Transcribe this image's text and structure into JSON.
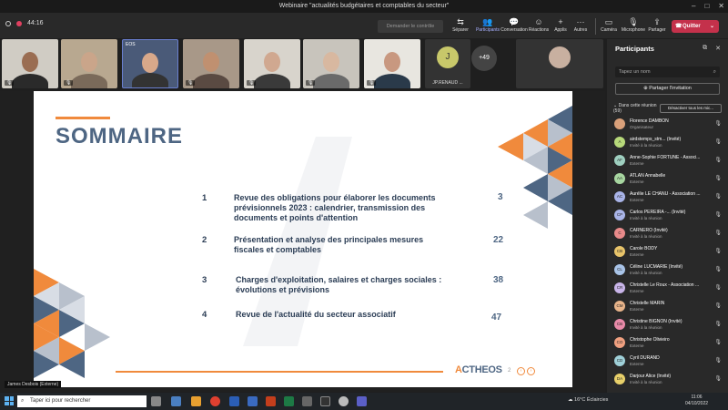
{
  "window": {
    "title": "Webinaire \"actualités budgétaires et comptables du secteur\"",
    "controls": [
      "–",
      "□",
      "✕"
    ]
  },
  "toolbar": {
    "timer": "44:16",
    "ask_control": "Demander le contrôle",
    "items": [
      {
        "label": "Séparer",
        "icon": "split-icon"
      },
      {
        "label": "Participants",
        "icon": "people-icon",
        "active": true
      },
      {
        "label": "Conversation",
        "icon": "chat-icon"
      },
      {
        "label": "Réactions",
        "icon": "reaction-icon"
      },
      {
        "label": "Applis",
        "icon": "apps-icon"
      },
      {
        "label": "Autres",
        "icon": "more-icon"
      },
      {
        "label": "Caméra",
        "icon": "camera-off-icon"
      },
      {
        "label": "Microphone",
        "icon": "mic-off-icon"
      },
      {
        "label": "Partager",
        "icon": "share-icon"
      }
    ],
    "leave": "Quitter"
  },
  "tiles": {
    "eos_tag": "EOS",
    "avatar_initial": "J",
    "avatar_name": "JP.RENAUD ...",
    "more_count": "+49"
  },
  "slide": {
    "heading": "SOMMAIRE",
    "items": [
      {
        "num": "1",
        "lines": [
          "Revue des obligations pour élaborer les documents",
          "prévisionnels 2023 : calendrier, transmission des",
          "documents et points d'attention"
        ],
        "page": "3"
      },
      {
        "num": "2",
        "lines": [
          "Présentation et analyse des principales mesures",
          "fiscales et comptables"
        ],
        "page": "22"
      },
      {
        "num": "3",
        "lines": [
          "Charges d'exploitation, salaires et charges sociales :",
          "évolutions et prévisions"
        ],
        "page": "38"
      },
      {
        "num": "4",
        "lines": [
          "Revue de l'actualité du secteur associatif"
        ],
        "page": "47"
      }
    ],
    "logo_a": "A",
    "logo_rest": "CTHEOS",
    "page_number": "2",
    "colors": {
      "orange": "#f08a3c",
      "navy": "#4e6683",
      "gray": "#b8c0cc"
    }
  },
  "presenter": "James Desbois (Externe)",
  "panel": {
    "title": "Participants",
    "search_placeholder": "Tapez un nom",
    "share_invite": "Partager l'invitation",
    "meeting_header": "Dans cette réunion",
    "meeting_count": "(59)",
    "mute_all": "Désactiver tous les mic...",
    "participants": [
      {
        "initials": "",
        "name": "Florence DAMBON",
        "role": "Organisateur",
        "color": "#d9a07a"
      },
      {
        "initials": "A",
        "name": "airdstemps_stm... (Invité)",
        "role": "Invité à la réunion",
        "color": "#b7d97a"
      },
      {
        "initials": "AF",
        "name": "Anne-Sophie FORTUNE - Associ...",
        "role": "Externe",
        "color": "#9fd0c0"
      },
      {
        "initials": "AA",
        "name": "ATLAN Annabelle",
        "role": "Externe",
        "color": "#a7d6a0"
      },
      {
        "initials": "AC",
        "name": "Aurélie LE CHANU - Association ...",
        "role": "Externe",
        "color": "#a9b4e8"
      },
      {
        "initials": "CP",
        "name": "Carlos PEREIRA -... (Invité)",
        "role": "Invité à la réunion",
        "color": "#a9b4e8"
      },
      {
        "initials": "C",
        "name": "CARNERO (Invité)",
        "role": "Invité à la réunion",
        "color": "#e88a8a"
      },
      {
        "initials": "CB",
        "name": "Carole BODY",
        "role": "Externe",
        "color": "#e8c46a"
      },
      {
        "initials": "CL",
        "name": "Céline LUCMARIE (Invité)",
        "role": "Invité à la réunion",
        "color": "#a9c4e8"
      },
      {
        "initials": "CR",
        "name": "Christelle Le Roux - Association ...",
        "role": "Externe",
        "color": "#c8b4e8"
      },
      {
        "initials": "CM",
        "name": "Christelle MARIN",
        "role": "Externe",
        "color": "#e8b48a"
      },
      {
        "initials": "CB",
        "name": "Christine BIGNON (Invité)",
        "role": "Invité à la réunion",
        "color": "#e88aa8"
      },
      {
        "initials": "CO",
        "name": "Christophe Olivieiro",
        "role": "Externe",
        "color": "#f0a080"
      },
      {
        "initials": "CD",
        "name": "Cyril DURAND",
        "role": "Externe",
        "color": "#9fd0d8"
      },
      {
        "initials": "DA",
        "name": "Darjour Alice (Invité)",
        "role": "Invité à la réunion",
        "color": "#e8d06a"
      }
    ]
  },
  "taskbar": {
    "search_placeholder": "Taper ici pour rechercher",
    "weather": "16°C  Éclaircies",
    "time": "11:06",
    "date": "04/10/2022"
  }
}
